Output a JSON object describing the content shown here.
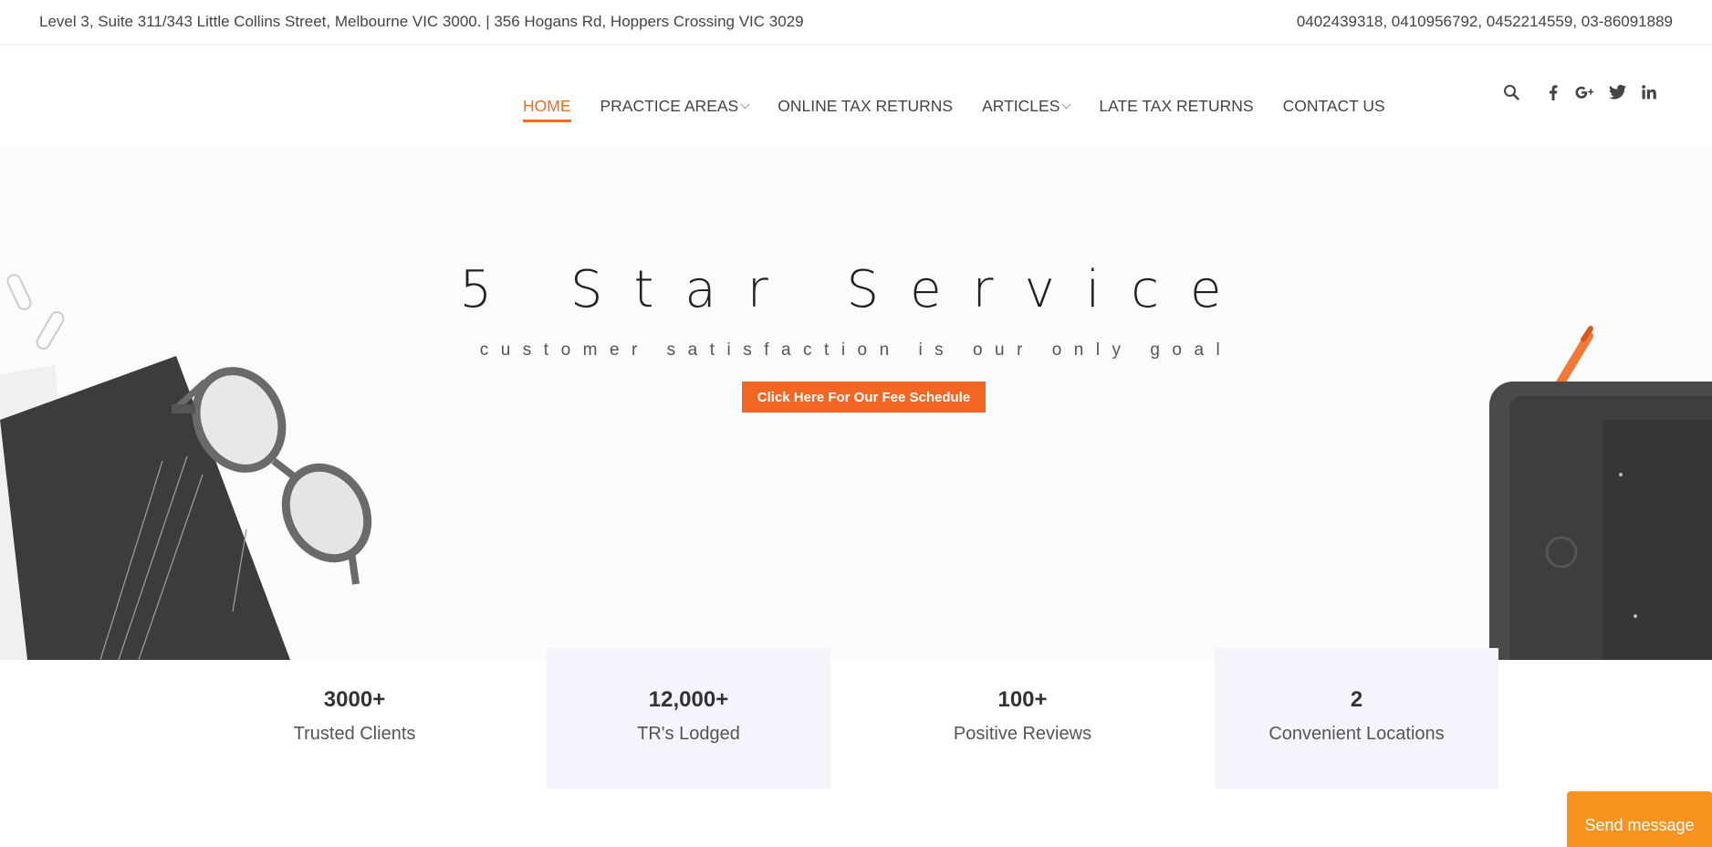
{
  "topbar": {
    "address": "Level 3, Suite 311/343 Little Collins Street, Melbourne VIC 3000. | 356 Hogans Rd, Hoppers Crossing VIC 3029",
    "phones": "0402439318, 0410956792, 0452214559, 03-86091889"
  },
  "nav": {
    "items": [
      {
        "label": "HOME",
        "active": true
      },
      {
        "label": "PRACTICE AREAS",
        "dropdown": true
      },
      {
        "label": "ONLINE TAX RETURNS"
      },
      {
        "label": "ARTICLES",
        "dropdown": true
      },
      {
        "label": "LATE TAX RETURNS"
      },
      {
        "label": "CONTACT US"
      }
    ]
  },
  "tools": [
    "search-icon",
    "facebook-icon",
    "google-plus-icon",
    "twitter-icon",
    "linkedin-icon"
  ],
  "hero": {
    "title": "5 Star Service",
    "subtitle": "customer satisfaction is our only goal",
    "cta_label": "Click Here For Our Fee Schedule"
  },
  "stats": [
    {
      "value": "3000+",
      "label": "Trusted Clients"
    },
    {
      "value": "12,000+",
      "label": "TR's Lodged"
    },
    {
      "value": "100+",
      "label": "Positive Reviews"
    },
    {
      "value": "2",
      "label": "Convenient Locations"
    }
  ],
  "chat": {
    "label": "Send message"
  },
  "colors": {
    "accent": "#f26a1b",
    "button": "#f26522",
    "chat": "#f7931e",
    "stat_bg": "#f4f5fc"
  }
}
